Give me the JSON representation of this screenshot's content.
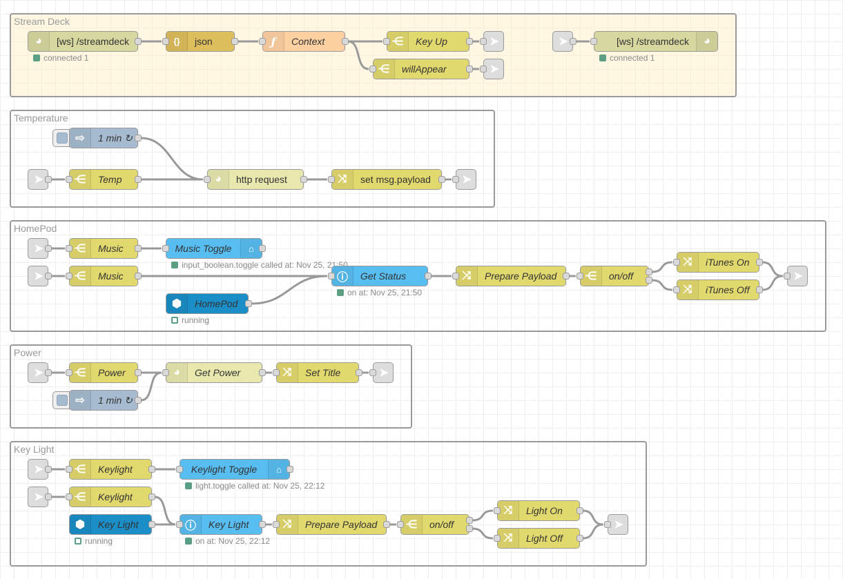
{
  "colors": {
    "websocket": "#d7d7a0",
    "json": "#debd5c",
    "function": "#fdd0a2",
    "switch": "#e2d96e",
    "change": "#e2d96e",
    "link": "#dddddd",
    "inject": "#a6bbcf",
    "http": "#e7e7ae",
    "ha_service": "#58bdf0",
    "ha_state": "#58bdf0",
    "ha_server": "#1b8ec7",
    "status_green": "#5a9e84"
  },
  "groups": [
    {
      "id": "stream-deck",
      "label": "Stream Deck"
    },
    {
      "id": "temperature",
      "label": "Temperature"
    },
    {
      "id": "homepod",
      "label": "HomePod"
    },
    {
      "id": "power",
      "label": "Power"
    },
    {
      "id": "key-light",
      "label": "Key Light"
    }
  ],
  "nodes": {
    "sd_ws_in": {
      "label": "[ws] /streamdeck",
      "icon": "globe-icon",
      "type": "websocket in",
      "status": "connected 1"
    },
    "sd_json": {
      "label": "json",
      "icon": "json-icon",
      "type": "json"
    },
    "sd_context": {
      "label": "Context",
      "icon": "function-icon",
      "type": "function"
    },
    "sd_keyup": {
      "label": "Key Up",
      "icon": "switch-icon",
      "type": "switch"
    },
    "sd_willappear": {
      "label": "willAppear",
      "icon": "switch-icon",
      "type": "switch"
    },
    "sd_ws_out": {
      "label": "[ws] /streamdeck",
      "icon": "globe-icon",
      "type": "websocket out",
      "status": "connected 1"
    },
    "t_inject": {
      "label": "1 min ↻",
      "icon": "inject-icon",
      "type": "inject"
    },
    "t_switch": {
      "label": "Temp",
      "icon": "switch-icon",
      "type": "switch"
    },
    "t_http": {
      "label": "http request",
      "icon": "globe-icon",
      "type": "http request"
    },
    "t_change": {
      "label": "set msg.payload",
      "icon": "change-icon",
      "type": "change"
    },
    "h_music1": {
      "label": "Music",
      "icon": "switch-icon",
      "type": "switch"
    },
    "h_toggle": {
      "label": "Music Toggle",
      "icon": "router-icon",
      "type": "call service",
      "status": "input_boolean.toggle called at: Nov 25, 21:50"
    },
    "h_music2": {
      "label": "Music",
      "icon": "switch-icon",
      "type": "switch"
    },
    "h_server": {
      "label": "HomePod",
      "icon": "server-icon",
      "type": "events",
      "status": "running"
    },
    "h_getstatus": {
      "label": "Get Status",
      "icon": "info-icon",
      "type": "current state",
      "status": "on at: Nov 25, 21:50"
    },
    "h_prepare": {
      "label": "Prepare Payload",
      "icon": "change-icon",
      "type": "change"
    },
    "h_onoff": {
      "label": "on/off",
      "icon": "switch-icon",
      "type": "switch"
    },
    "h_on": {
      "label": "iTunes On",
      "icon": "change-icon",
      "type": "change"
    },
    "h_off": {
      "label": "iTunes Off",
      "icon": "change-icon",
      "type": "change"
    },
    "p_switch": {
      "label": "Power",
      "icon": "switch-icon",
      "type": "switch"
    },
    "p_inject": {
      "label": "1 min ↻",
      "icon": "inject-icon",
      "type": "inject"
    },
    "p_get": {
      "label": "Get Power",
      "icon": "globe-icon",
      "type": "http request"
    },
    "p_settitle": {
      "label": "Set Title",
      "icon": "change-icon",
      "type": "change"
    },
    "k_kl1": {
      "label": "Keylight",
      "icon": "switch-icon",
      "type": "switch"
    },
    "k_toggle": {
      "label": "Keylight Toggle",
      "icon": "router-icon",
      "type": "call service",
      "status": "light.toggle called at: Nov 25, 22:12"
    },
    "k_kl2": {
      "label": "Keylight",
      "icon": "switch-icon",
      "type": "switch"
    },
    "k_server": {
      "label": "Key Light",
      "icon": "server-icon",
      "type": "events",
      "status": "running"
    },
    "k_state": {
      "label": "Key Light",
      "icon": "info-icon",
      "type": "current state",
      "status": "on at: Nov 25, 22:12"
    },
    "k_prepare": {
      "label": "Prepare Payload",
      "icon": "change-icon",
      "type": "change"
    },
    "k_onoff": {
      "label": "on/off",
      "icon": "switch-icon",
      "type": "switch"
    },
    "k_on": {
      "label": "Light On",
      "icon": "change-icon",
      "type": "change"
    },
    "k_off": {
      "label": "Light Off",
      "icon": "change-icon",
      "type": "change"
    }
  }
}
